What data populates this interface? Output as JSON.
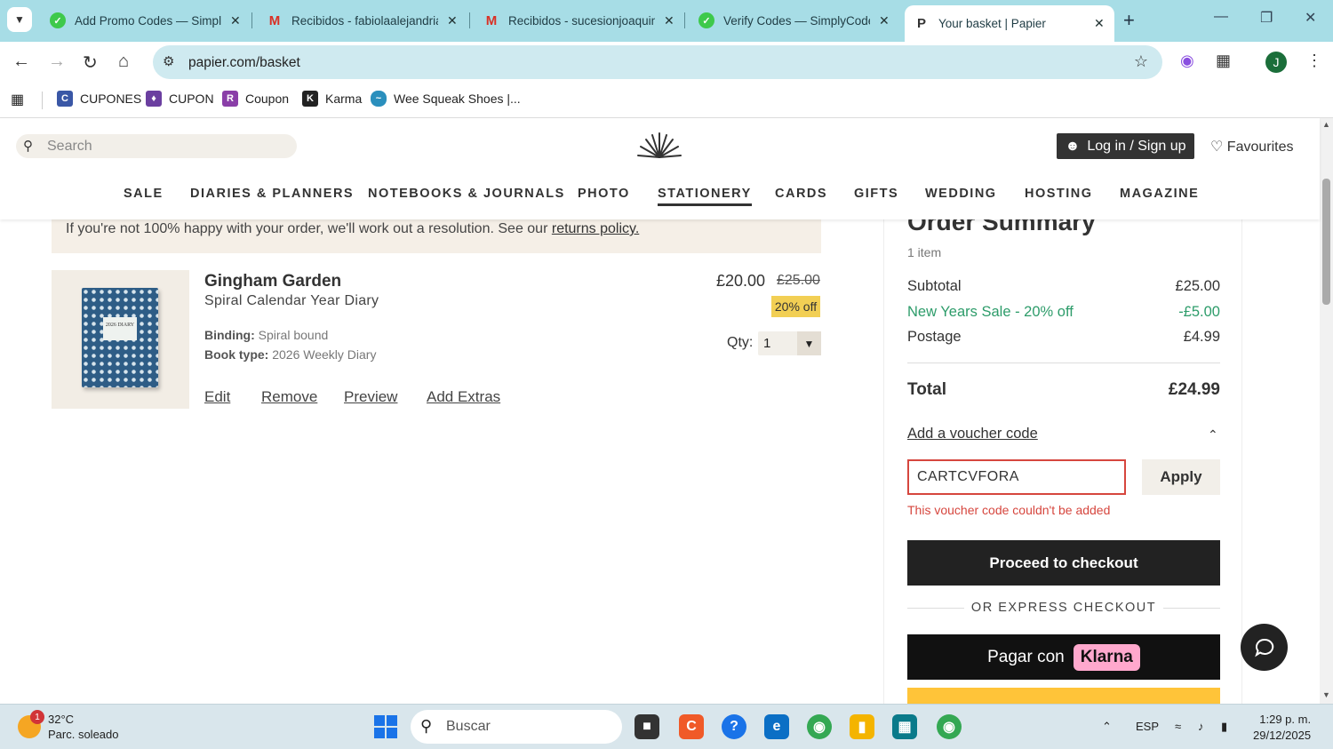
{
  "browser": {
    "tabs": [
      {
        "title": "Add Promo Codes — Simply",
        "favicon_color": "#3ec94b"
      },
      {
        "title": "Recibidos - fabiolaalejandria",
        "favicon_color": "#d93025"
      },
      {
        "title": "Recibidos - sucesionjoaquin",
        "favicon_color": "#d93025"
      },
      {
        "title": "Verify Codes — SimplyCode",
        "favicon_color": "#3ec94b"
      },
      {
        "title": "Your basket | Papier",
        "favicon_color": "#333333",
        "favicon_text": "P"
      }
    ],
    "url": "papier.com/basket",
    "bookmarks": [
      {
        "label": "CUPONES",
        "color": "#3a57a6"
      },
      {
        "label": "CUPON",
        "color": "#6b3fa0"
      },
      {
        "label": "Coupon",
        "color": "#8a3ea8"
      },
      {
        "label": "Karma",
        "color": "#222222"
      },
      {
        "label": "Wee Squeak Shoes |...",
        "color": "#2a8fbd"
      }
    ]
  },
  "site": {
    "search_placeholder": "Search",
    "login_label": "Log in / Sign up",
    "favourites_label": "Favourites",
    "nav": [
      "SALE",
      "DIARIES & PLANNERS",
      "NOTEBOOKS & JOURNALS",
      "PHOTO",
      "STATIONERY",
      "CARDS",
      "GIFTS",
      "WEDDING",
      "HOSTING",
      "MAGAZINE"
    ],
    "active_nav": "STATIONERY"
  },
  "basket": {
    "notice_text": "If you're not 100% happy with your order, we'll work out a resolution. See our ",
    "notice_link": "returns policy.",
    "item": {
      "name": "Gingham Garden",
      "subtitle": "Spiral Calendar Year Diary",
      "cover_label": "2026 DIARY",
      "binding_label": "Binding:",
      "binding_value": "Spiral bound",
      "booktype_label": "Book type:",
      "booktype_value": "2026 Weekly Diary",
      "price_now": "£20.00",
      "price_was": "£25.00",
      "discount": "20% off",
      "qty_label": "Qty:",
      "qty_value": "1",
      "links": [
        "Edit",
        "Remove",
        "Preview",
        "Add Extras"
      ]
    }
  },
  "summary": {
    "heading": "Order Summary",
    "count": "1 item",
    "subtotal_label": "Subtotal",
    "subtotal_value": "£25.00",
    "sale_label": "New Years Sale - 20% off",
    "sale_value": "-£5.00",
    "postage_label": "Postage",
    "postage_value": "£4.99",
    "total_label": "Total",
    "total_value": "£24.99",
    "voucher_link": "Add a voucher code",
    "voucher_value": "CARTCVFORA",
    "apply_label": "Apply",
    "voucher_error": "This voucher code couldn't be added",
    "checkout_label": "Proceed to checkout",
    "express_label": "OR EXPRESS CHECKOUT",
    "klarna_prefix": "Pagar con",
    "klarna_logo": "Klarna"
  },
  "taskbar": {
    "temp": "32°C",
    "weather": "Parc. soleado",
    "weather_badge": "1",
    "search_placeholder": "Buscar",
    "lang": "ESP",
    "time": "1:29 p. m.",
    "date": "29/12/2025"
  }
}
